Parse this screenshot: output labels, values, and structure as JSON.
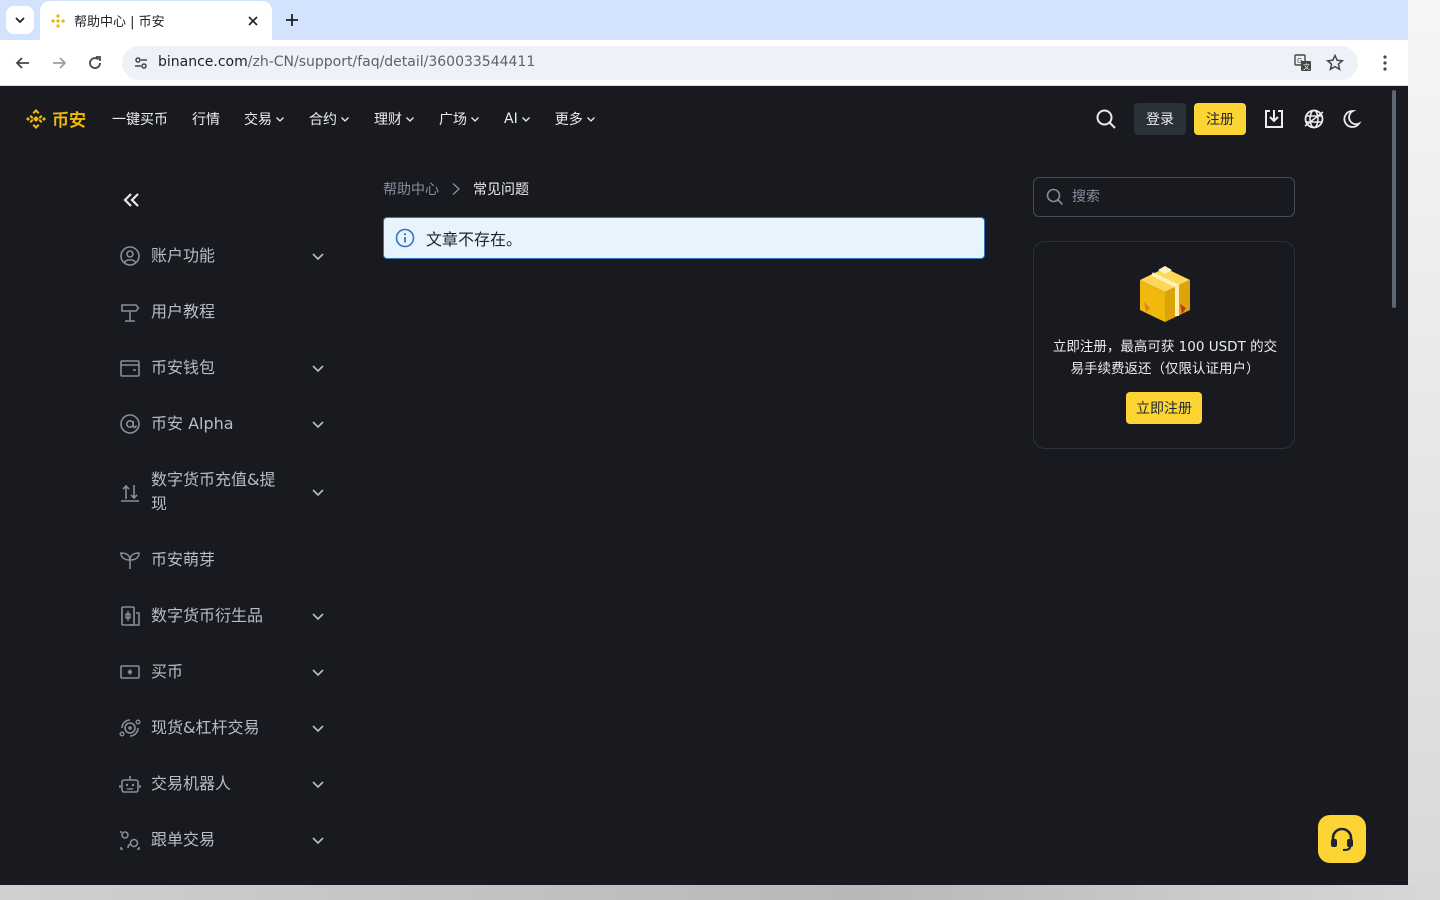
{
  "browser": {
    "tab_title": "帮助中心 | 币安",
    "url_host": "binance.com",
    "url_path": "/zh-CN/support/faq/detail/360033544411"
  },
  "header": {
    "logo_text": "币安",
    "nav": [
      {
        "label": "一键买币",
        "has_menu": false
      },
      {
        "label": "行情",
        "has_menu": false
      },
      {
        "label": "交易",
        "has_menu": true
      },
      {
        "label": "合约",
        "has_menu": true
      },
      {
        "label": "理财",
        "has_menu": true
      },
      {
        "label": "广场",
        "has_menu": true
      },
      {
        "label": "AI",
        "has_menu": true
      },
      {
        "label": "更多",
        "has_menu": true
      }
    ],
    "login_label": "登录",
    "register_label": "注册"
  },
  "sidebar": {
    "items": [
      {
        "label": "账户功能",
        "icon": "user-circle-icon",
        "expandable": true
      },
      {
        "label": "用户教程",
        "icon": "signpost-icon",
        "expandable": false
      },
      {
        "label": "币安钱包",
        "icon": "wallet-icon",
        "expandable": true
      },
      {
        "label": "币安 Alpha",
        "icon": "at-sign-icon",
        "expandable": true
      },
      {
        "label": "数字货币充值&提现",
        "icon": "deposit-withdraw-icon",
        "expandable": true
      },
      {
        "label": "币安萌芽",
        "icon": "sprout-icon",
        "expandable": false
      },
      {
        "label": "数字货币衍生品",
        "icon": "derivatives-icon",
        "expandable": true
      },
      {
        "label": "买币",
        "icon": "cash-icon",
        "expandable": true
      },
      {
        "label": "现货&杠杆交易",
        "icon": "spot-trading-icon",
        "expandable": true
      },
      {
        "label": "交易机器人",
        "icon": "robot-icon",
        "expandable": true
      },
      {
        "label": "跟单交易",
        "icon": "copy-trading-icon",
        "expandable": true
      }
    ]
  },
  "main": {
    "breadcrumb": {
      "home": "帮助中心",
      "current": "常见问题"
    },
    "alert_text": "文章不存在。"
  },
  "right_rail": {
    "search_placeholder": "搜索",
    "promo_text": "立即注册，最高可获 100 USDT 的交易手续费返还（仅限认证用户）",
    "promo_button": "立即注册"
  },
  "colors": {
    "brand": "#F0B90B",
    "button_yellow": "#FCD535",
    "page_bg": "#181A20",
    "alert_bg": "#E8F4FD",
    "alert_border": "#3375BB"
  }
}
